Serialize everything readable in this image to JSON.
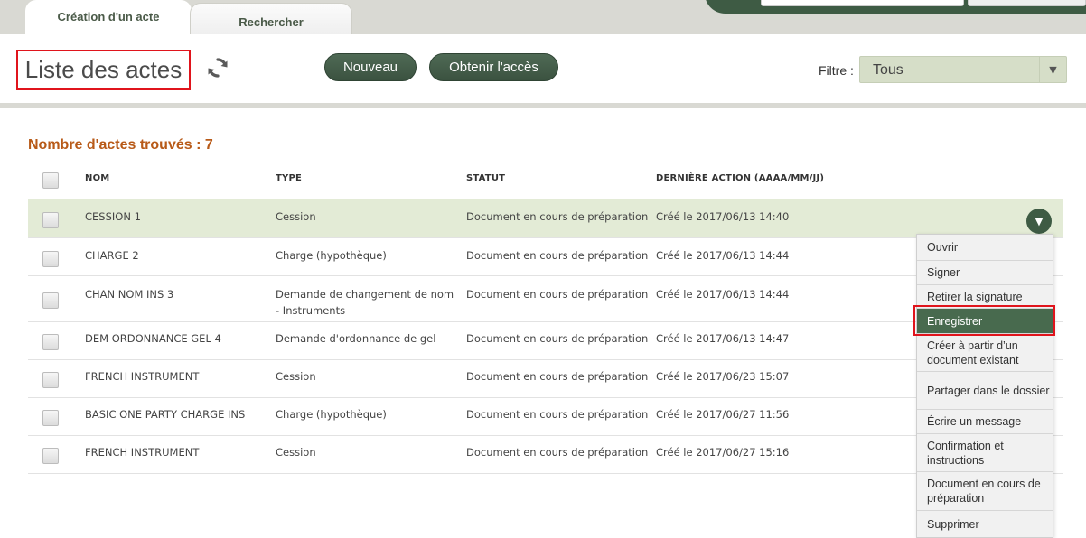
{
  "tabs": [
    {
      "label": "Création d'un acte",
      "active": true
    },
    {
      "label": "Rechercher",
      "active": false
    }
  ],
  "header": {
    "title": "Liste des actes",
    "refresh_icon": "refresh-icon",
    "buttons": {
      "new": "Nouveau",
      "access": "Obtenir l'accès"
    },
    "filter": {
      "label": "Filtre :",
      "value": "Tous"
    }
  },
  "colors": {
    "accent": "#3e5b44",
    "count": "#b85a18",
    "selected_row": "#e3ebd6",
    "highlight_border": "#e0141c"
  },
  "list": {
    "count_label": "Nombre d'actes trouvés : 7",
    "columns": {
      "name": "NOM",
      "type": "TYPE",
      "status": "STATUT",
      "last_action": "DERNIÈRE ACTION (AAAA/MM/JJ)"
    },
    "rows": [
      {
        "name": "CESSION 1",
        "type": "Cession",
        "status": "Document en cours de préparation",
        "last_action": "Créé le 2017/06/13 14:40",
        "selected": true
      },
      {
        "name": "CHARGE 2",
        "type": "Charge (hypothèque)",
        "status": "Document en cours de préparation",
        "last_action": "Créé le 2017/06/13 14:44"
      },
      {
        "name": "CHAN NOM INS 3",
        "type": "Demande de changement de nom - Instruments",
        "status": "Document en cours de préparation",
        "last_action": "Créé le 2017/06/13 14:44"
      },
      {
        "name": "DEM ORDONNANCE GEL 4",
        "type": "Demande d'ordonnance de gel",
        "status": "Document en cours de préparation",
        "last_action": "Créé le 2017/06/13 14:47"
      },
      {
        "name": "FRENCH INSTRUMENT",
        "type": "Cession",
        "status": "Document en cours de préparation",
        "last_action": "Créé le 2017/06/23 15:07"
      },
      {
        "name": "BASIC ONE PARTY CHARGE INS",
        "type": "Charge (hypothèque)",
        "status": "Document en cours de préparation",
        "last_action": "Créé le 2017/06/27 11:56"
      },
      {
        "name": "FRENCH INSTRUMENT",
        "type": "Cession",
        "status": "Document en cours de préparation",
        "last_action": "Créé le 2017/06/27 15:16"
      }
    ]
  },
  "menu": {
    "items": [
      "Ouvrir",
      "Signer",
      "Retirer la signature",
      "Enregistrer",
      "Créer à partir d’un document existant",
      "Partager dans le dossier",
      "Écrire un message",
      "Confirmation et instructions",
      "Document en cours de préparation",
      "Supprimer"
    ],
    "highlighted": "Enregistrer"
  }
}
